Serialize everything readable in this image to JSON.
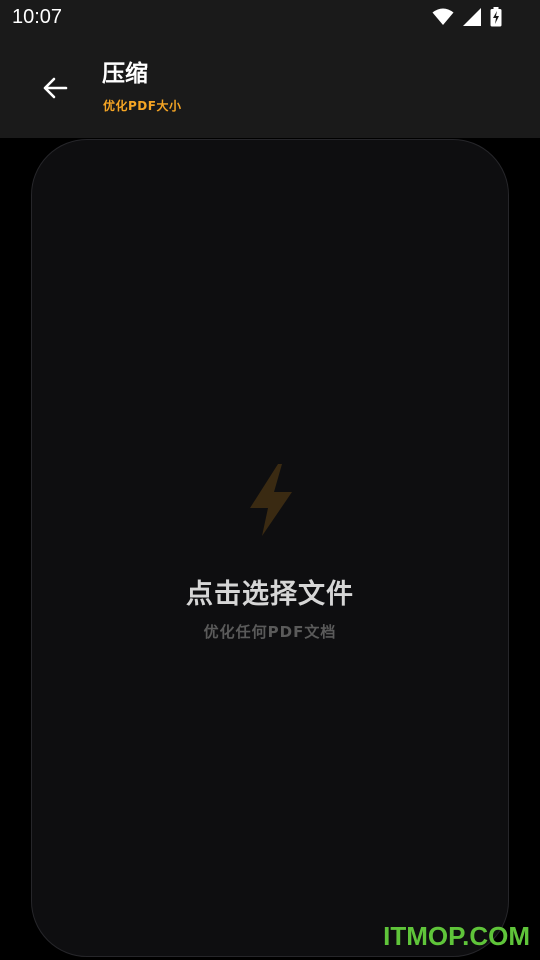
{
  "status_bar": {
    "time": "10:07",
    "icons": [
      "wifi-icon",
      "cell-signal-icon",
      "battery-charging-icon"
    ]
  },
  "app_bar": {
    "back_icon": "arrow-back-icon",
    "title": "压缩",
    "subtitle": "优化PDF大小"
  },
  "picker": {
    "icon": "bolt-icon",
    "title": "点击选择文件",
    "subtitle": "优化任何PDF文档"
  },
  "watermark": "ITMOP.COM",
  "colors": {
    "accent": "#f5a524",
    "bar_background": "#1a1a1a",
    "card_background": "#0e0e10",
    "watermark": "#5fc43a"
  }
}
